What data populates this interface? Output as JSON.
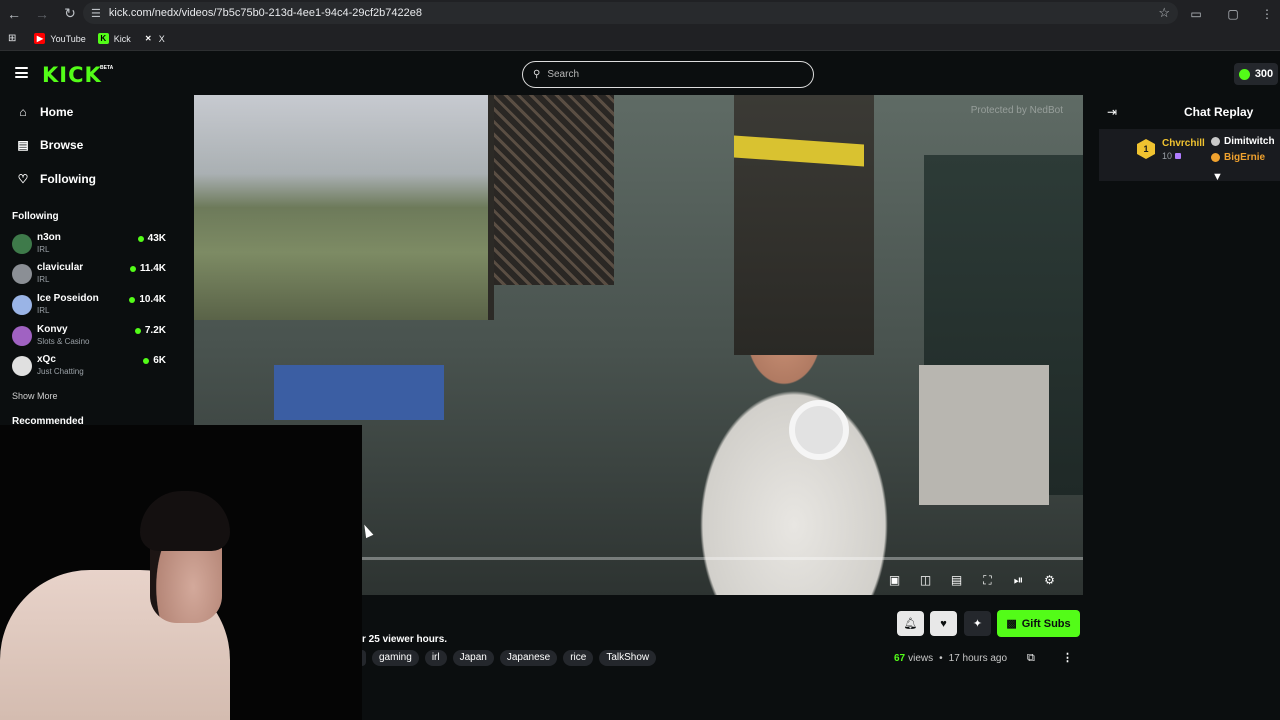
{
  "browser": {
    "url": "kick.com/nedx/videos/7b5c75b0-213d-4ee1-94c4-29cf2b7422e8",
    "bookmarks": [
      {
        "label": "YouTube",
        "icon": "youtube-icon",
        "color": "#ff0000"
      },
      {
        "label": "Kick",
        "icon": "kick-icon",
        "color": "#53fc18"
      },
      {
        "label": "X",
        "icon": "x-icon",
        "color": "#ffffff"
      }
    ]
  },
  "header": {
    "logo": "KICK",
    "beta": "BETA",
    "search_placeholder": "Search",
    "points": "300",
    "accent": "#53fc18"
  },
  "sidebar": {
    "nav": [
      {
        "label": "Home",
        "icon": "home-icon"
      },
      {
        "label": "Browse",
        "icon": "browse-icon"
      },
      {
        "label": "Following",
        "icon": "heart-icon"
      }
    ],
    "following_heading": "Following",
    "following": [
      {
        "name": "n3on",
        "category": "IRL",
        "viewers": "43K",
        "avatar_color": "#3e7a4a"
      },
      {
        "name": "clavicular",
        "category": "IRL",
        "viewers": "11.4K",
        "avatar_color": "#8b8f95"
      },
      {
        "name": "Ice Poseidon",
        "category": "IRL",
        "viewers": "10.4K",
        "avatar_color": "#9ab4e6"
      },
      {
        "name": "Konvy",
        "category": "Slots & Casino",
        "viewers": "7.2K",
        "avatar_color": "#a062c2"
      },
      {
        "name": "xQc",
        "category": "Just Chatting",
        "viewers": "6K",
        "avatar_color": "#e0e0e0"
      }
    ],
    "show_more": "Show More",
    "recommended_heading": "Recommended"
  },
  "video": {
    "watermark": "Protected by NedBot"
  },
  "chat": {
    "title": "Chat Replay",
    "top_gifter": {
      "rank": "1",
      "name": "Chvrchill",
      "count": "10"
    },
    "users": [
      {
        "name": "Dimitwitch",
        "color": "#ffffff",
        "badge_color": "#c9c9c9"
      },
      {
        "name": "BigErnie",
        "color": "#f0a22e",
        "badge_color": "#f0a22e"
      }
    ]
  },
  "below": {
    "viewer_hours": "r 25 viewer hours.",
    "tags": [
      "gaming",
      "irl",
      "Japan",
      "Japanese",
      "rice",
      "TalkShow"
    ],
    "gift_label": "Gift Subs",
    "views_count": "67",
    "views_label": "views",
    "age": "17 hours ago"
  }
}
